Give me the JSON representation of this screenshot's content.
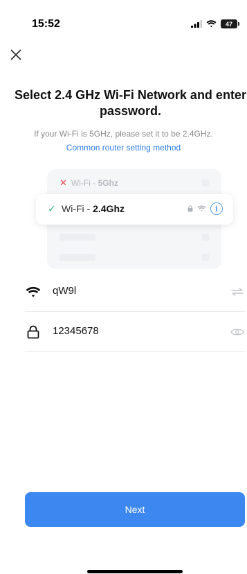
{
  "status_bar": {
    "time": "15:52",
    "battery_level": "47",
    "icons": [
      "cellular-signal-icon",
      "wifi-icon",
      "battery-icon"
    ]
  },
  "header": {
    "close_icon": "close-icon"
  },
  "title": "Select 2.4 GHz Wi-Fi Network and enter password.",
  "subtitle": "If your Wi-Fi is 5GHz, please set it to be 2.4GHz.",
  "router_link": "Common router setting method",
  "illustration": {
    "bad_network_prefix": "Wi-Fi - ",
    "bad_network_band": "5Ghz",
    "good_network_prefix": "Wi-Fi - ",
    "good_network_band": "2.4Ghz",
    "card_icons": [
      "lock-icon",
      "wifi-icon",
      "info-icon"
    ],
    "info_glyph": "i"
  },
  "form": {
    "ssid": {
      "icon": "wifi-icon",
      "value": "qW9l",
      "action_icon": "switch-network-icon"
    },
    "password": {
      "icon": "lock-icon",
      "value": "12345678",
      "action_icon": "eye-icon"
    }
  },
  "next_label": "Next",
  "colors": {
    "accent": "#3d87f0",
    "link": "#2f7de1",
    "success": "#36b37e",
    "error": "#e54848"
  }
}
